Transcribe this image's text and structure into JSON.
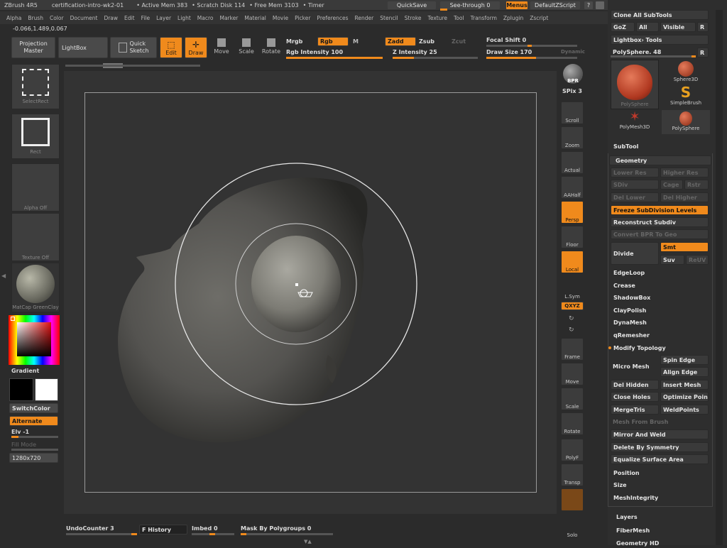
{
  "title": {
    "app": "ZBrush 4R5",
    "doc": "certification-intro-wk2-01",
    "active_mem": "• Active Mem 383",
    "scratch": "• Scratch Disk 114",
    "free_mem": "• Free Mem 3103",
    "timer": "• Timer",
    "quicksave": "QuickSave",
    "seethrough": "See-through  0",
    "menus": "Menus",
    "script": "DefaultZScript"
  },
  "menu": [
    "Alpha",
    "Brush",
    "Color",
    "Document",
    "Draw",
    "Edit",
    "File",
    "Layer",
    "Light",
    "Macro",
    "Marker",
    "Material",
    "Movie",
    "Picker",
    "Preferences",
    "Render",
    "Stencil",
    "Stroke",
    "Texture",
    "Tool",
    "Transform",
    "Zplugin",
    "Zscript"
  ],
  "coords": "-0.066,1.489,0.067",
  "toolbar": {
    "projection": "Projection\nMaster",
    "lightbox": "LightBox",
    "quick_sketch": "Quick\nSketch",
    "edit": "Edit",
    "draw": "Draw",
    "move": "Move",
    "scale": "Scale",
    "rotate": "Rotate",
    "mrgb": "Mrgb",
    "rgb": "Rgb",
    "m": "M",
    "zadd": "Zadd",
    "zsub": "Zsub",
    "zcut": "Zcut",
    "rgb_intensity": "Rgb  Intensity 100",
    "z_intensity": "Z  Intensity 25",
    "focal_shift": "Focal Shift 0",
    "draw_size": "Draw Size 170",
    "dynamic": "Dynamic"
  },
  "left": {
    "select_rect": "SelectRect",
    "rect": "Rect",
    "alpha_off": "Alpha  Off",
    "texture_off": "Texture  Off",
    "matcap": "MatCap GreenClay",
    "gradient": "Gradient",
    "switch_color": "SwitchColor",
    "alternate": "Alternate",
    "elv": "Elv -1",
    "fill_mode": "Fill Mode",
    "doc_size": "1280x720"
  },
  "shelf": [
    {
      "id": "bpr",
      "label": "BPR"
    },
    {
      "id": "spix",
      "label": "SPix 3"
    },
    {
      "id": "scroll",
      "label": "Scroll"
    },
    {
      "id": "zoom",
      "label": "Zoom"
    },
    {
      "id": "actual",
      "label": "Actual"
    },
    {
      "id": "aahalf",
      "label": "AAHalf"
    },
    {
      "id": "persp",
      "label": "Persp"
    },
    {
      "id": "floor",
      "label": "Floor"
    },
    {
      "id": "local",
      "label": "Local"
    },
    {
      "id": "lsym",
      "label": "L.Sym"
    },
    {
      "id": "xyz",
      "label": "QXYZ"
    },
    {
      "id": "frame",
      "label": "Frame"
    },
    {
      "id": "move",
      "label": "Move"
    },
    {
      "id": "scale",
      "label": "Scale"
    },
    {
      "id": "rotate",
      "label": "Rotate"
    },
    {
      "id": "polyf",
      "label": "PolyF"
    },
    {
      "id": "transp",
      "label": "Transp"
    },
    {
      "id": "solo",
      "label": "Solo"
    }
  ],
  "bottom": {
    "undo": "UndoCounter 3",
    "history": "F History",
    "imbed": "Imbed 0",
    "mask": "Mask By Polygroups 0"
  },
  "right": {
    "clone_all": "Clone All SubTools",
    "goz": "GoZ",
    "all": "All",
    "visible": "Visible",
    "r": "R",
    "lightbox_tools": "Lightbox› Tools",
    "polysphere_slider": "PolySphere. 48",
    "tools": [
      {
        "label": "PolySphere"
      },
      {
        "label": "Sphere3D"
      },
      {
        "label": "SimpleBrush"
      },
      {
        "label": "PolyMesh3D"
      },
      {
        "label": "PolySphere"
      }
    ],
    "subtool": "SubTool",
    "geometry": "Geometry",
    "lower_res": "Lower Res",
    "higher_res": "Higher Res",
    "sdiv": "SDiv",
    "cage": "Cage",
    "rstr": "Rstr",
    "del_lower": "Del Lower",
    "del_higher": "Del Higher",
    "freeze": "Freeze SubDivision Levels",
    "reconstruct": "Reconstruct Subdiv",
    "convert_bpr": "Convert BPR To Geo",
    "divide": "Divide",
    "smt": "Smt",
    "suv": "Suv",
    "reuv": "ReUV",
    "edgeloop": "EdgeLoop",
    "crease": "Crease",
    "shadowbox": "ShadowBox",
    "claypolish": "ClayPolish",
    "dynamesh": "DynaMesh",
    "qremesher": "qRemesher",
    "modify_topology": "Modify Topology",
    "micro_mesh": "Micro Mesh",
    "spin_edge": "Spin Edge",
    "align_edge": "Align Edge",
    "del_hidden": "Del Hidden",
    "insert_mesh": "Insert Mesh",
    "close_holes": "Close Holes",
    "optimize_points": "Optimize Poin",
    "mergetris": "MergeTris",
    "weldpoints": "WeldPoints",
    "mesh_from_brush": "Mesh From Brush",
    "mirror_weld": "Mirror And Weld",
    "delete_symmetry": "Delete By Symmetry",
    "equalize": "Equalize Surface Area",
    "position": "Position",
    "size": "Size",
    "meshintegrity": "MeshIntegrity",
    "layers": "Layers",
    "fibermesh": "FiberMesh",
    "geometry_hd": "Geometry HD"
  },
  "colors": {
    "accent": "#f08a1c",
    "bg": "#2b2b2b",
    "canvas": "#333333"
  }
}
